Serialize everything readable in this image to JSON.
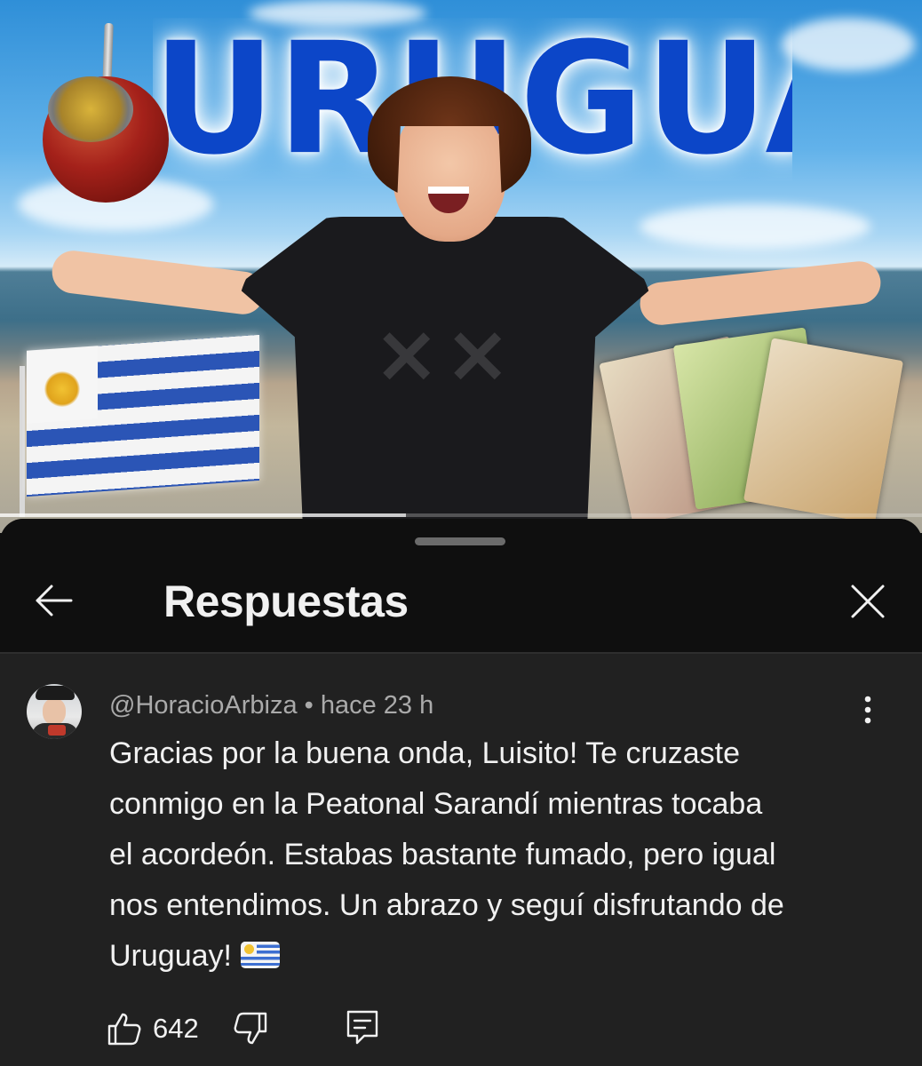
{
  "thumbnail": {
    "title_text": "URUGUAY",
    "progress_fraction": 0.44
  },
  "sheet": {
    "title": "Respuestas",
    "back_icon": "arrow-left-icon",
    "close_icon": "close-icon"
  },
  "comment": {
    "author": "@HoracioArbiza",
    "separator": " • ",
    "time": "hace 23 h",
    "body_lines": [
      "Gracias por la buena onda, Luisito! Te cruzaste",
      "conmigo en la Peatonal Sarandí mientras tocaba",
      "el acordeón. Estabas bastante fumado, pero igual",
      "nos entendimos. Un abrazo y seguí disfrutando de",
      "Uruguay!"
    ],
    "more_icon": "more-vertical-icon",
    "like_icon": "thumbs-up-icon",
    "like_count": "642",
    "dislike_icon": "thumbs-down-icon",
    "reply_icon": "reply-icon"
  },
  "colors": {
    "sheet_background": "#212121",
    "header_background": "#0f0f0f",
    "primary_text": "#f1f1f1",
    "secondary_text": "#aaaaaa"
  }
}
